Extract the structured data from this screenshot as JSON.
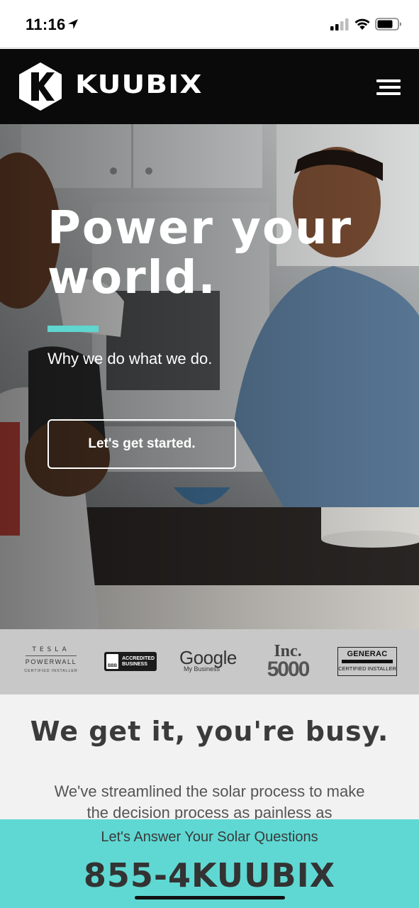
{
  "status_bar": {
    "time": "11:16",
    "icons": [
      "location-arrow-icon",
      "cellular-signal-icon",
      "wifi-icon",
      "battery-icon"
    ]
  },
  "header": {
    "brand": "KUUBIX",
    "logo_icon": "kuubix-hexagon-logo",
    "menu_icon": "hamburger-menu-icon"
  },
  "hero": {
    "title_line1": "Power your",
    "title_line2": "world.",
    "subtitle": "Why we do what we do.",
    "cta_label": "Let's get started.",
    "accent_color": "#5fd6cf"
  },
  "partners": {
    "tesla": {
      "word": "TESLA",
      "product": "POWERWALL",
      "cert": "CERTIFIED INSTALLER"
    },
    "bbb": {
      "mark": "BBB",
      "line1": "ACCREDITED",
      "line2": "BUSINESS"
    },
    "google": {
      "word": "Google",
      "sub": "My Business"
    },
    "inc": {
      "word": "Inc.",
      "num": "5000"
    },
    "generac": {
      "word": "GENERAC",
      "cert": "CERTIFIED INSTALLER"
    }
  },
  "busy": {
    "title": "We get it, you're busy.",
    "text": "We've streamlined the solar process to make the decision process as painless as"
  },
  "sticky_cta": {
    "label": "Let's Answer Your Solar Questions",
    "phone": "855-4KUUBIX",
    "background": "#5fd8d3"
  }
}
